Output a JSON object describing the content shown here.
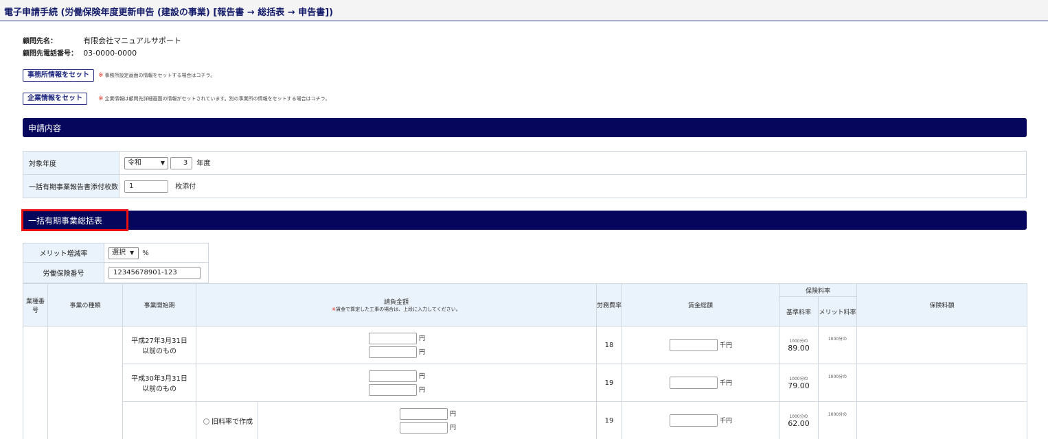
{
  "page_title": "電子申請手続 (労働保険年度更新申告 (建設の事業) [報告書 → 総括表 → 申告書])",
  "client": {
    "name_label": "顧問先名：",
    "name_value": "有限会社マニュアルサポート",
    "phone_label": "顧問先電話番号：",
    "phone_value": "03-0000-0000"
  },
  "buttons": {
    "office_info": "事務所情報をセット",
    "office_note_mark": "※",
    "office_note": "事務所設定画面の情報をセットする場合はコチラ。",
    "company_info": "企業情報をセット",
    "company_note_mark": "※",
    "company_note": "企業情報は顧問先詳細画面の情報がセットされています。別の事業所の情報をセットする場合はコチラ。"
  },
  "application": {
    "section_title": "申請内容",
    "year_label": "対象年度",
    "era_value": "令和",
    "year_value": "3",
    "year_suffix": "年度",
    "attach_label": "一括有期事業報告書添付枚数",
    "attach_value": "1",
    "attach_suffix": "枚添付"
  },
  "summary": {
    "section_title": "一括有期事業総括表",
    "merit_label": "メリット増減率",
    "merit_select": "選択",
    "merit_unit": "%",
    "insurance_no_label": "労働保険番号",
    "insurance_no_value": "12345678901-123"
  },
  "grid": {
    "headers": {
      "industry_no": "業種番号",
      "business_type": "事業の種類",
      "start_period": "事業開始期",
      "contract_amount": "請負金額",
      "contract_note_mark": "※",
      "contract_note": "賃金で算定した工事の場合は、上段に入力してください。",
      "labor_rate": "労務費率",
      "total_wages": "賃金総額",
      "insurance_rate": "保険料率",
      "base_rate": "基準料率",
      "merit_rate": "メリット料率",
      "premium": "保険料額"
    },
    "rows": [
      {
        "period": "平成27年3月31日以前のもの",
        "yen_top": "円",
        "yen_bottom": "円",
        "labor_rate": "18",
        "wage_unit": "千円",
        "per_mille_base": "1000分の",
        "base_rate": "89.00",
        "per_mille_merit": "1000分の"
      },
      {
        "period": "平成30年3月31日以前のもの",
        "yen_top": "円",
        "yen_bottom": "円",
        "labor_rate": "19",
        "wage_unit": "千円",
        "per_mille_base": "1000分の",
        "base_rate": "79.00",
        "per_mille_merit": "1000分の"
      },
      {
        "period": "",
        "radio_label": "旧料率で作成",
        "yen_top": "円",
        "yen_bottom": "円",
        "labor_rate": "19",
        "wage_unit": "千円",
        "per_mille_base": "1000分の",
        "base_rate": "62.00",
        "per_mille_merit": "1000分の"
      }
    ]
  },
  "colors": {
    "section_bg": "#06065c",
    "label_cell_bg": "#eaf2fb",
    "highlight": "#e81010",
    "note_mark": "#e03020"
  }
}
